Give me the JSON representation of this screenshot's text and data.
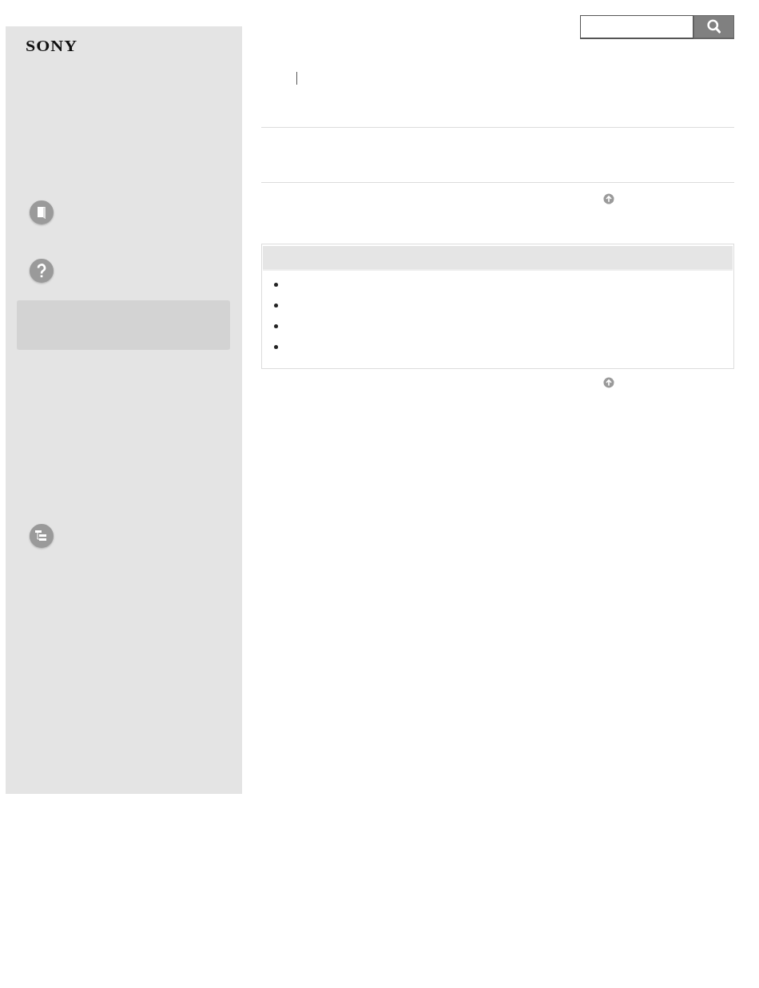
{
  "logo": "SONY",
  "sidebar": {
    "items": [
      {
        "kind": "manual"
      },
      {
        "kind": "help"
      },
      {
        "kind": "panel"
      },
      {
        "kind": "contents"
      }
    ]
  },
  "search": {
    "kind": "box"
  },
  "notes": {
    "items": [
      {
        "kind": "bullet"
      },
      {
        "kind": "bullet"
      },
      {
        "kind": "bullet"
      },
      {
        "kind": "bullet"
      }
    ]
  }
}
